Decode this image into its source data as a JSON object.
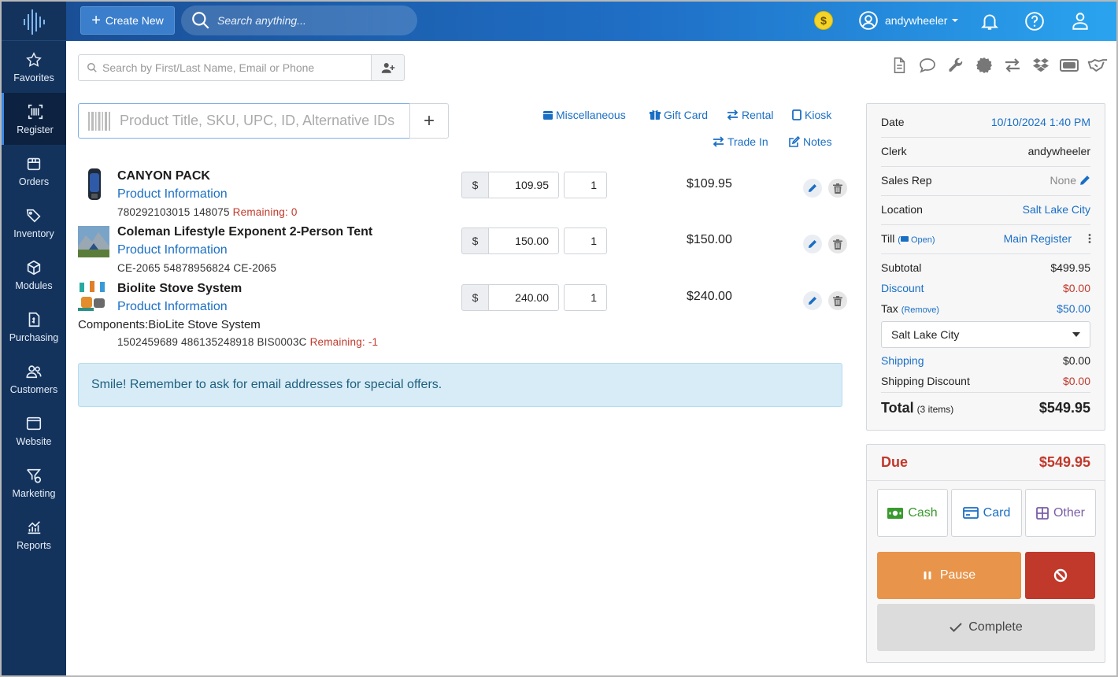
{
  "sidebar": {
    "items": [
      {
        "label": "Favorites"
      },
      {
        "label": "Register"
      },
      {
        "label": "Orders"
      },
      {
        "label": "Inventory"
      },
      {
        "label": "Modules"
      },
      {
        "label": "Purchasing"
      },
      {
        "label": "Customers"
      },
      {
        "label": "Website"
      },
      {
        "label": "Marketing"
      },
      {
        "label": "Reports"
      }
    ],
    "active": "Register"
  },
  "topbar": {
    "create_label": "Create New",
    "search_placeholder": "Search anything...",
    "coin_symbol": "$",
    "username": "andywheeler"
  },
  "customer_search": {
    "placeholder": "Search by First/Last Name, Email or Phone"
  },
  "product_search": {
    "placeholder": "Product Title, SKU, UPC, ID, Alternative IDs",
    "add_symbol": "+"
  },
  "quick_links": {
    "miscellaneous": "Miscellaneous",
    "gift_card": "Gift Card",
    "rental": "Rental",
    "kiosk": "Kiosk",
    "trade_in": "Trade In",
    "notes": "Notes"
  },
  "cart": {
    "currency_symbol": "$",
    "info_label": "Product Information",
    "remaining_label": "Remaining:",
    "items": [
      {
        "name": "CANYON PACK",
        "ids": "780292103015  148075",
        "remaining": "0",
        "price": "109.95",
        "qty": "1",
        "total": "$109.95"
      },
      {
        "name": "Coleman Lifestyle Exponent 2-Person Tent",
        "ids": "CE-2065 54878956824  CE-2065",
        "remaining": "",
        "price": "150.00",
        "qty": "1",
        "total": "$150.00"
      },
      {
        "name": "Biolite Stove System",
        "components": "Components:BioLite Stove System",
        "ids": "1502459689 486135248918  BIS0003C",
        "remaining": "-1",
        "price": "240.00",
        "qty": "1",
        "total": "$240.00"
      }
    ]
  },
  "notice": "Smile! Remember to ask for email addresses for special offers.",
  "summary": {
    "date_label": "Date",
    "date_value": "10/10/2024 1:40 PM",
    "clerk_label": "Clerk",
    "clerk_value": "andywheeler",
    "salesrep_label": "Sales Rep",
    "salesrep_value": "None",
    "location_label": "Location",
    "location_value": "Salt Lake City",
    "till_label": "Till",
    "till_status": "Open",
    "till_value": "Main Register",
    "subtotal_label": "Subtotal",
    "subtotal_value": "$499.95",
    "discount_label": "Discount",
    "discount_value": "$0.00",
    "tax_label": "Tax",
    "tax_remove": "(Remove)",
    "tax_value": "$50.00",
    "tax_location": "Salt Lake City",
    "shipping_label": "Shipping",
    "shipping_value": "$0.00",
    "shipdisc_label": "Shipping Discount",
    "shipdisc_value": "$0.00",
    "total_label": "Total",
    "total_items": "(3 items)",
    "total_value": "$549.95"
  },
  "payment": {
    "due_label": "Due",
    "due_value": "$549.95",
    "cash": "Cash",
    "card": "Card",
    "other": "Other",
    "pause": "Pause",
    "complete": "Complete"
  },
  "colors": {
    "accent": "#1a6fc4",
    "sidebar": "#14335c",
    "danger": "#c0392b",
    "pause": "#e8944a"
  }
}
